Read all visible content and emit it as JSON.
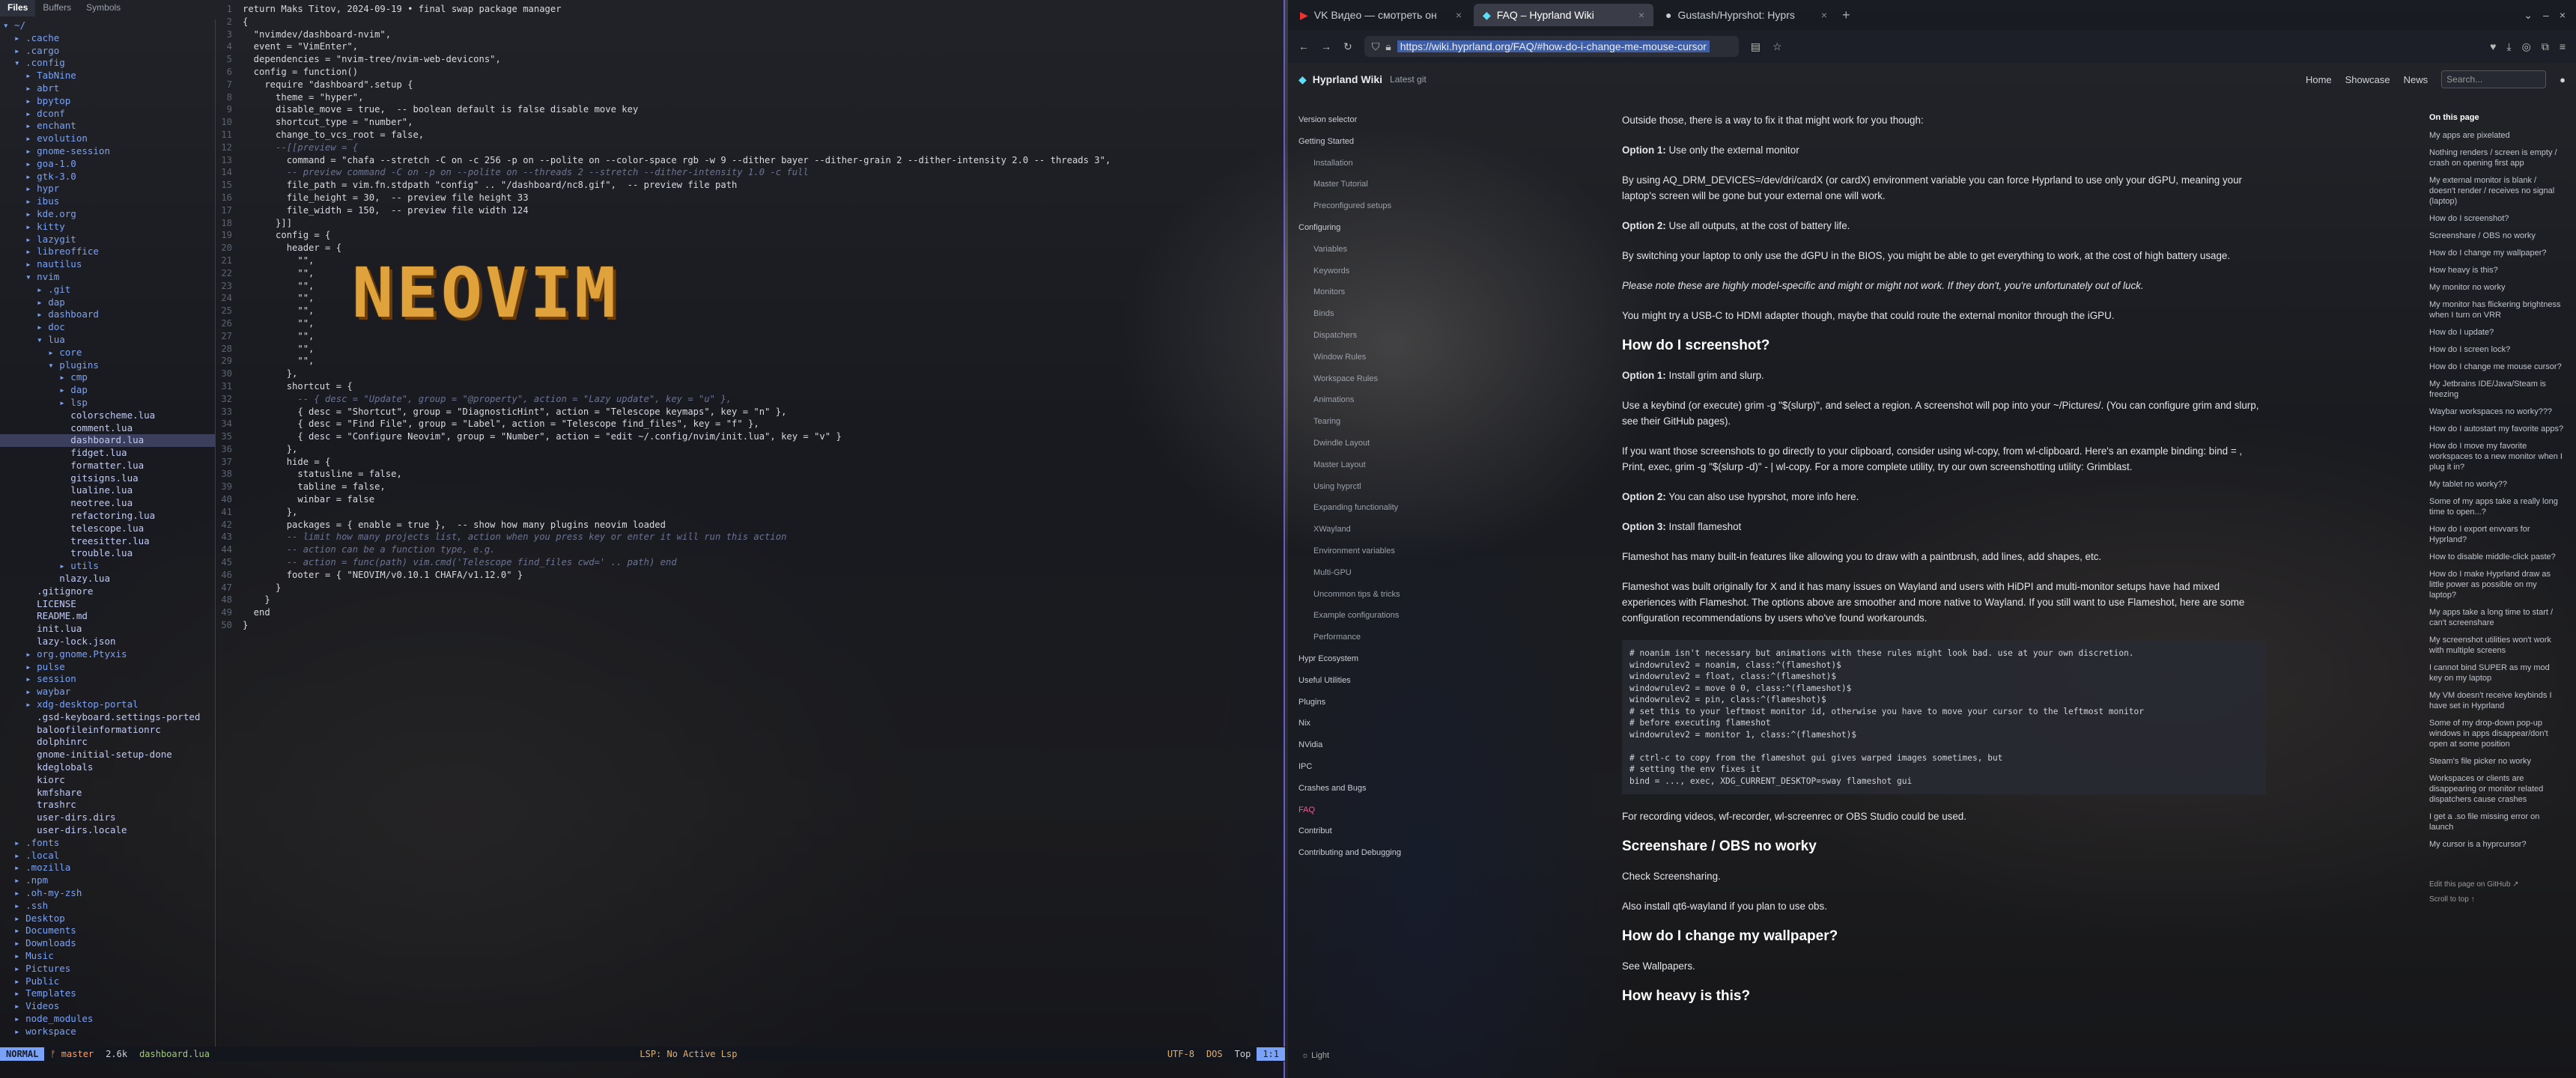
{
  "terminal": {
    "tabs": [
      "Files",
      "Buffers",
      "Symbols"
    ]
  },
  "tree": [
    {
      "t": "▾ ~/",
      "c": "dir"
    },
    {
      "t": "  ▸ .cache",
      "c": "dir"
    },
    {
      "t": "  ▸ .cargo",
      "c": "dir"
    },
    {
      "t": "  ▾ .config",
      "c": "dir"
    },
    {
      "t": "    ▸ TabNine",
      "c": "dir"
    },
    {
      "t": "    ▸ abrt",
      "c": "dir"
    },
    {
      "t": "    ▸ bpytop",
      "c": "dir"
    },
    {
      "t": "    ▸ dconf",
      "c": "dir"
    },
    {
      "t": "    ▸ enchant",
      "c": "dir"
    },
    {
      "t": "    ▸ evolution",
      "c": "dir"
    },
    {
      "t": "    ▸ gnome-session",
      "c": "dir"
    },
    {
      "t": "    ▸ goa-1.0",
      "c": "dir"
    },
    {
      "t": "    ▸ gtk-3.0",
      "c": "dir"
    },
    {
      "t": "    ▸ hypr",
      "c": "dir"
    },
    {
      "t": "    ▸ ibus",
      "c": "dir"
    },
    {
      "t": "    ▸ kde.org",
      "c": "dir"
    },
    {
      "t": "    ▸ kitty",
      "c": "dir"
    },
    {
      "t": "    ▸ lazygit",
      "c": "dir"
    },
    {
      "t": "    ▸ libreoffice",
      "c": "dir"
    },
    {
      "t": "    ▸ nautilus",
      "c": "dir"
    },
    {
      "t": "    ▾ nvim",
      "c": "dir"
    },
    {
      "t": "      ▸ .git",
      "c": "dir"
    },
    {
      "t": "      ▸ dap",
      "c": "dir"
    },
    {
      "t": "      ▸ dashboard",
      "c": "dir"
    },
    {
      "t": "      ▸ doc",
      "c": "dir"
    },
    {
      "t": "      ▾ lua",
      "c": "dir"
    },
    {
      "t": "        ▸ core",
      "c": "dir"
    },
    {
      "t": "        ▾ plugins",
      "c": "dir"
    },
    {
      "t": "          ▸ cmp",
      "c": "dir"
    },
    {
      "t": "          ▸ dap",
      "c": "dir"
    },
    {
      "t": "          ▸ lsp",
      "c": "dir"
    },
    {
      "t": "            colorscheme.lua",
      "c": "fil"
    },
    {
      "t": "            comment.lua",
      "c": "fil"
    },
    {
      "t": "            dashboard.lua",
      "c": "fil",
      "sel": true
    },
    {
      "t": "            fidget.lua",
      "c": "fil"
    },
    {
      "t": "            formatter.lua",
      "c": "fil"
    },
    {
      "t": "            gitsigns.lua",
      "c": "fil"
    },
    {
      "t": "            lualine.lua",
      "c": "fil"
    },
    {
      "t": "            neotree.lua",
      "c": "fil"
    },
    {
      "t": "            refactoring.lua",
      "c": "fil"
    },
    {
      "t": "            telescope.lua",
      "c": "fil"
    },
    {
      "t": "            treesitter.lua",
      "c": "fil"
    },
    {
      "t": "            trouble.lua",
      "c": "fil"
    },
    {
      "t": "          ▸ utils",
      "c": "dir"
    },
    {
      "t": "          nlazy.lua",
      "c": "fil"
    },
    {
      "t": "      .gitignore",
      "c": "fil"
    },
    {
      "t": "      LICENSE",
      "c": "fil"
    },
    {
      "t": "      README.md",
      "c": "fil"
    },
    {
      "t": "      init.lua",
      "c": "fil"
    },
    {
      "t": "      lazy-lock.json",
      "c": "fil"
    },
    {
      "t": "    ▸ org.gnome.Ptyxis",
      "c": "dir"
    },
    {
      "t": "    ▸ pulse",
      "c": "dir"
    },
    {
      "t": "    ▸ session",
      "c": "dir"
    },
    {
      "t": "    ▸ waybar",
      "c": "dir"
    },
    {
      "t": "    ▸ xdg-desktop-portal",
      "c": "dir"
    },
    {
      "t": "      .gsd-keyboard.settings-ported",
      "c": "fil"
    },
    {
      "t": "      baloofileinformationrc",
      "c": "fil"
    },
    {
      "t": "      dolphinrc",
      "c": "fil"
    },
    {
      "t": "      gnome-initial-setup-done",
      "c": "fil"
    },
    {
      "t": "      kdeglobals",
      "c": "fil"
    },
    {
      "t": "      kiorc",
      "c": "fil"
    },
    {
      "t": "      kmfshare",
      "c": "fil"
    },
    {
      "t": "      trashrc",
      "c": "fil"
    },
    {
      "t": "      user-dirs.dirs",
      "c": "fil"
    },
    {
      "t": "      user-dirs.locale",
      "c": "fil"
    },
    {
      "t": "  ▸ .fonts",
      "c": "dir"
    },
    {
      "t": "  ▸ .local",
      "c": "dir"
    },
    {
      "t": "  ▸ .mozilla",
      "c": "dir"
    },
    {
      "t": "  ▸ .npm",
      "c": "dir"
    },
    {
      "t": "  ▸ .oh-my-zsh",
      "c": "dir"
    },
    {
      "t": "  ▸ .ssh",
      "c": "dir"
    },
    {
      "t": "  ▸ Desktop",
      "c": "dir"
    },
    {
      "t": "  ▸ Documents",
      "c": "dir"
    },
    {
      "t": "  ▸ Downloads",
      "c": "dir"
    },
    {
      "t": "  ▸ Music",
      "c": "dir"
    },
    {
      "t": "  ▸ Pictures",
      "c": "dir"
    },
    {
      "t": "  ▸ Public",
      "c": "dir"
    },
    {
      "t": "  ▸ Templates",
      "c": "dir"
    },
    {
      "t": "  ▸ Videos",
      "c": "dir"
    },
    {
      "t": "  ▸ node_modules",
      "c": "dir"
    },
    {
      "t": "  ▸ workspace",
      "c": "dir"
    }
  ],
  "code": [
    "return Maks Titov, 2024-09-19 • final swap package manager",
    "{",
    "  \"nvimdev/dashboard-nvim\",",
    "  event = \"VimEnter\",",
    "  dependencies = \"nvim-tree/nvim-web-devicons\",",
    "  config = function()",
    "    require \"dashboard\".setup {",
    "      theme = \"hyper\",",
    "      disable_move = true,  -- boolean default is false disable move key",
    "      shortcut_type = \"number\",",
    "      change_to_vcs_root = false,",
    "      --[[preview = {",
    "        command = \"chafa --stretch -C on -c 256 -p on --polite on --color-space rgb -w 9 --dither bayer --dither-grain 2 --dither-intensity 2.0 -- threads 3\",",
    "        -- preview command -C on -p on --polite on --threads 2 --stretch --dither-intensity 1.0 -c full",
    "        file_path = vim.fn.stdpath \"config\" .. \"/dashboard/nc8.gif\",  -- preview file path",
    "        file_height = 30,  -- preview file height 33",
    "        file_width = 150,  -- preview file width 124",
    "      }]]",
    "      config = {",
    "        header = {",
    "          \"\",",
    "          \"\",",
    "          \"\",",
    "          \"\",",
    "          \"\",",
    "          \"\",",
    "          \"\",",
    "          \"\",",
    "          \"\",",
    "        },",
    "        shortcut = {",
    "          -- { desc = \"Update\", group = \"@property\", action = \"Lazy update\", key = \"u\" },",
    "          { desc = \"Shortcut\", group = \"DiagnosticHint\", action = \"Telescope keymaps\", key = \"n\" },",
    "          { desc = \"Find File\", group = \"Label\", action = \"Telescope find_files\", key = \"f\" },",
    "          { desc = \"Configure Neovim\", group = \"Number\", action = \"edit ~/.config/nvim/init.lua\", key = \"v\" }",
    "        },",
    "        hide = {",
    "          statusline = false,",
    "          tabline = false,",
    "          winbar = false",
    "        },",
    "        packages = { enable = true },  -- show how many plugins neovim loaded",
    "        -- limit how many projects list, action when you press key or enter it will run this action",
    "        -- action can be a function type, e.g.",
    "        -- action = func(path) vim.cmd('Telescope find_files cwd=' .. path) end",
    "        footer = { \"NEOVIM/v0.10.1 CHAFA/v1.12.0\" }",
    "      }",
    "    }",
    "  end",
    "}"
  ],
  "banner": "NEOVIM",
  "status": {
    "mode": "NORMAL",
    "branch": "master",
    "size": "2.6k",
    "file": "dashboard.lua",
    "lsp": "LSP: No Active Lsp",
    "enc": "UTF-8",
    "os": "DOS",
    "pos": "Top",
    "line": "1:1"
  },
  "browser": {
    "tabs": [
      "VK Видео — смотреть он",
      "FAQ – Hyprland Wiki",
      "Gustash/Hyprshot: Hyprs"
    ],
    "url_host": "https://wiki.hyprland.org/FAQ/",
    "url_frag": "#how-do-i-change-me-mouse-cursor",
    "wiki_brand": "Hyprland Wiki",
    "wiki_ver": "Latest git",
    "nav": [
      "Home",
      "Showcase",
      "News"
    ],
    "search_placeholder": "Search...",
    "sidebar": [
      {
        "t": "Version selector",
        "k": "sec"
      },
      {
        "t": "Getting Started",
        "k": "sec"
      },
      {
        "t": "Installation",
        "k": "sub"
      },
      {
        "t": "Master Tutorial",
        "k": "sub"
      },
      {
        "t": "Preconfigured setups",
        "k": "sub"
      },
      {
        "t": "Configuring",
        "k": "sec"
      },
      {
        "t": "Variables",
        "k": "sub"
      },
      {
        "t": "Keywords",
        "k": "sub"
      },
      {
        "t": "Monitors",
        "k": "sub"
      },
      {
        "t": "Binds",
        "k": "sub"
      },
      {
        "t": "Dispatchers",
        "k": "sub"
      },
      {
        "t": "Window Rules",
        "k": "sub"
      },
      {
        "t": "Workspace Rules",
        "k": "sub"
      },
      {
        "t": "Animations",
        "k": "sub"
      },
      {
        "t": "Tearing",
        "k": "sub"
      },
      {
        "t": "Dwindle Layout",
        "k": "sub"
      },
      {
        "t": "Master Layout",
        "k": "sub"
      },
      {
        "t": "Using hyprctl",
        "k": "sub"
      },
      {
        "t": "Expanding functionality",
        "k": "sub"
      },
      {
        "t": "XWayland",
        "k": "sub"
      },
      {
        "t": "Environment variables",
        "k": "sub"
      },
      {
        "t": "Multi-GPU",
        "k": "sub"
      },
      {
        "t": "Uncommon tips & tricks",
        "k": "sub"
      },
      {
        "t": "Example configurations",
        "k": "sub"
      },
      {
        "t": "Performance",
        "k": "sub"
      },
      {
        "t": "Hypr Ecosystem",
        "k": "sec"
      },
      {
        "t": "Useful Utilities",
        "k": "sec"
      },
      {
        "t": "Plugins",
        "k": "sec"
      },
      {
        "t": "Nix",
        "k": "sec"
      },
      {
        "t": "NVidia",
        "k": "sec"
      },
      {
        "t": "IPC",
        "k": "sec"
      },
      {
        "t": "Crashes and Bugs",
        "k": "sec"
      },
      {
        "t": "FAQ",
        "k": "faq"
      },
      {
        "t": "Contribut",
        "k": "sec"
      },
      {
        "t": "Contributing and Debugging",
        "k": "sec"
      }
    ],
    "toc_title": "On this page",
    "toc": [
      "My apps are pixelated",
      "Nothing renders / screen is empty / crash on opening first app",
      "My external monitor is blank / doesn't render / receives no signal (laptop)",
      "How do I screenshot?",
      "Screenshare / OBS no worky",
      "How do I change my wallpaper?",
      "How heavy is this?",
      "My monitor no worky",
      "My monitor has flickering brightness when I turn on VRR",
      "How do I update?",
      "How do I screen lock?",
      "How do I change me mouse cursor?",
      "My Jetbrains IDE/Java/Steam is freezing",
      "Waybar workspaces no worky???",
      "How do I autostart my favorite apps?",
      "How do I move my favorite workspaces to a new monitor when I plug it in?",
      "My tablet no worky??",
      "Some of my apps take a really long time to open...?",
      "How do I export envvars for Hyprland?",
      "How to disable middle-click paste?",
      "How do I make Hyprland draw as little power as possible on my laptop?",
      "My apps take a long time to start / can't screenshare",
      "My screenshot utilities won't work with multiple screens",
      "I cannot bind SUPER as my mod key on my laptop",
      "My VM doesn't receive keybinds I have set in Hyprland",
      "Some of my drop-down pop-up windows in apps disappear/don't open at some position",
      "Steam's file picker no worky",
      "Workspaces or clients are disappearing or monitor related dispatchers cause crashes",
      "I get a .so file missing error on launch",
      "My cursor is a hyprcursor?"
    ],
    "toc_foot": [
      "Edit this page on GitHub ↗",
      "Scroll to top ↑"
    ],
    "light_label": "Light"
  },
  "article": {
    "p0": "Outside those, there is a way to fix it that might work for you though:",
    "opt1a_b": "Option 1:",
    "opt1a": " Use only the external monitor",
    "p1a": "By using AQ_DRM_DEVICES=/dev/dri/cardX (or cardX) environment variable you can force Hyprland to use only your dGPU, meaning your laptop's screen will be gone but your external one will work.",
    "opt2a_b": "Option 2:",
    "opt2a": " Use all outputs, at the cost of battery life.",
    "p2a": "By switching your laptop to only use the dGPU in the BIOS, you might be able to get everything to work, at the cost of high battery usage.",
    "warn": "Please note these are highly model-specific and might or might not work. If they don't, you're unfortunately out of luck.",
    "p3": "You might try a USB-C to HDMI adapter though, maybe that could route the external monitor through the iGPU.",
    "h_ss": "How do I screenshot?",
    "opt1b_b": "Option 1:",
    "opt1b": " Install grim and slurp.",
    "p4": "Use a keybind (or execute) grim -g \"$(slurp)\", and select a region. A screenshot will pop into your ~/Pictures/. (You can configure grim and slurp, see their GitHub pages).",
    "p5": "If you want those screenshots to go directly to your clipboard, consider using wl-copy, from wl-clipboard. Here's an example binding: bind = , Print, exec, grim -g \"$(slurp -d)\" - | wl-copy. For a more complete utility, try our own screenshotting utility: Grimblast.",
    "opt2b_b": "Option 2:",
    "opt2b": " You can also use hyprshot, more info here.",
    "opt3_b": "Option 3:",
    "opt3": " Install flameshot",
    "p6": "Flameshot has many built-in features like allowing you to draw with a paintbrush, add lines, add shapes, etc.",
    "p7": "Flameshot was built originally for X and it has many issues on Wayland and users with HiDPI and multi-monitor setups have had mixed experiences with Flameshot. The options above are smoother and more native to Wayland. If you still want to use Flameshot, here are some configuration recommendations by users who've found workarounds.",
    "code": "# noanim isn't necessary but animations with these rules might look bad. use at your own discretion.\nwindowrulev2 = noanim, class:^(flameshot)$\nwindowrulev2 = float, class:^(flameshot)$\nwindowrulev2 = move 0 0, class:^(flameshot)$\nwindowrulev2 = pin, class:^(flameshot)$\n# set this to your leftmost monitor id, otherwise you have to move your cursor to the leftmost monitor\n# before executing flameshot\nwindowrulev2 = monitor 1, class:^(flameshot)$\n\n# ctrl-c to copy from the flameshot gui gives warped images sometimes, but\n# setting the env fixes it\nbind = ..., exec, XDG_CURRENT_DESKTOP=sway flameshot gui",
    "p8": "For recording videos, wf-recorder, wl-screenrec or OBS Studio could be used.",
    "h_obs": "Screenshare / OBS no worky",
    "p9": "Check Screensharing.",
    "p10": "Also install qt6-wayland if you plan to use obs.",
    "h_wp": "How do I change my wallpaper?",
    "p11": "See Wallpapers.",
    "h_heavy": "How heavy is this?"
  }
}
